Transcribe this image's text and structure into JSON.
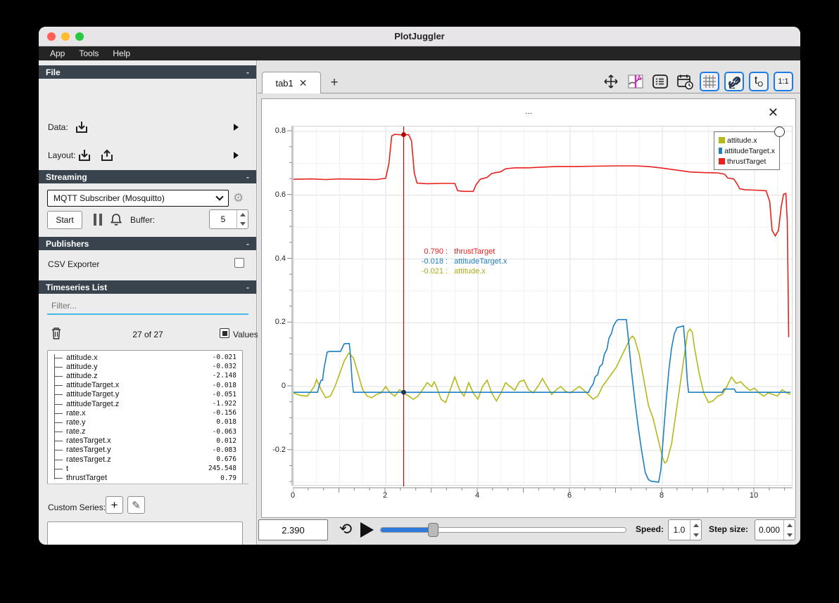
{
  "window": {
    "title": "PlotJuggler"
  },
  "menubar": {
    "items": [
      "App",
      "Tools",
      "Help"
    ]
  },
  "sidebar": {
    "file": {
      "header": "File",
      "data_label": "Data:",
      "layout_label": "Layout:"
    },
    "streaming": {
      "header": "Streaming",
      "source_selected": "MQTT Subscriber (Mosquitto)",
      "start_label": "Start",
      "buffer_label": "Buffer:",
      "buffer_value": "5"
    },
    "publishers": {
      "header": "Publishers",
      "csv_exporter_label": "CSV Exporter"
    },
    "timeseries": {
      "header": "Timeseries List",
      "filter_placeholder": "Filter...",
      "count_text": "27 of 27",
      "values_label": "Values",
      "items": [
        {
          "name": "attitude.x",
          "value": "-0.021"
        },
        {
          "name": "attitude.y",
          "value": "-0.032"
        },
        {
          "name": "attitude.z",
          "value": "-2.148"
        },
        {
          "name": "attitudeTarget.x",
          "value": "-0.018"
        },
        {
          "name": "attitudeTarget.y",
          "value": "-0.051"
        },
        {
          "name": "attitudeTarget.z",
          "value": "-1.922"
        },
        {
          "name": "rate.x",
          "value": "-0.156"
        },
        {
          "name": "rate.y",
          "value": "0.018"
        },
        {
          "name": "rate.z",
          "value": "-0.063"
        },
        {
          "name": "ratesTarget.x",
          "value": "0.012"
        },
        {
          "name": "ratesTarget.y",
          "value": "-0.083"
        },
        {
          "name": "ratesTarget.z",
          "value": "0.676"
        },
        {
          "name": "t",
          "value": "245.548"
        },
        {
          "name": "thrustTarget",
          "value": "0.79"
        }
      ]
    },
    "custom_series": {
      "label": "Custom Series:"
    }
  },
  "tabs": {
    "active": "tab1"
  },
  "toolbar_icons": {
    "time_offset_t": "t",
    "time_offset_sub": "O",
    "ratio_label": "1:1"
  },
  "plot": {
    "title": "..."
  },
  "tooltip": {
    "lines": [
      {
        "value": "0.790",
        "name": "thrustTarget",
        "color": "#e8211c"
      },
      {
        "value": "-0.018",
        "name": "attitudeTarget.x",
        "color": "#1d7fc4"
      },
      {
        "value": "-0.021",
        "name": "attitude.x",
        "color": "#a9ad15"
      }
    ]
  },
  "transport": {
    "time_value": "2.390",
    "slider_fraction": 0.21,
    "speed_label": "Speed:",
    "speed_value": "1.0",
    "step_label": "Step size:",
    "step_value": "0.000"
  },
  "chart_data": {
    "type": "line",
    "title": "...",
    "x_range": [
      0,
      10.84
    ],
    "y_range": [
      -0.313,
      0.8155
    ],
    "x_ticks": [
      0,
      2,
      4,
      6,
      8,
      10
    ],
    "y_ticks": [
      -0.2,
      0,
      0.2,
      0.4,
      0.6,
      0.8
    ],
    "grid": true,
    "legend_position": "top-right",
    "tracker": {
      "x": 2.39,
      "dots": [
        {
          "y": 0.79,
          "color": "#b00000"
        },
        {
          "y": -0.018,
          "color": "#1d3557"
        }
      ]
    },
    "series": [
      {
        "name": "attitude.x",
        "color": "#b4b819",
        "points": [
          [
            0,
            -0.02
          ],
          [
            0.15,
            -0.028
          ],
          [
            0.3,
            -0.03
          ],
          [
            0.45,
            0
          ],
          [
            0.5,
            0.022
          ],
          [
            0.6,
            -0.01
          ],
          [
            0.7,
            -0.035
          ],
          [
            0.8,
            -0.03
          ],
          [
            0.9,
            0
          ],
          [
            1,
            0.04
          ],
          [
            1.1,
            0.08
          ],
          [
            1.2,
            0.105
          ],
          [
            1.3,
            0.09
          ],
          [
            1.4,
            0.04
          ],
          [
            1.5,
            -0.01
          ],
          [
            1.6,
            -0.03
          ],
          [
            1.7,
            -0.035
          ],
          [
            1.8,
            -0.025
          ],
          [
            1.9,
            -0.02
          ],
          [
            2,
            0
          ],
          [
            2.1,
            -0.02
          ],
          [
            2.2,
            -0.03
          ],
          [
            2.3,
            -0.01
          ],
          [
            2.39,
            -0.021
          ],
          [
            2.5,
            -0.03
          ],
          [
            2.6,
            -0.04
          ],
          [
            2.7,
            -0.03
          ],
          [
            2.8,
            -0.01
          ],
          [
            2.9,
            0.012
          ],
          [
            3,
            0
          ],
          [
            3.05,
            0.015
          ],
          [
            3.1,
            0
          ],
          [
            3.2,
            -0.04
          ],
          [
            3.3,
            -0.05
          ],
          [
            3.4,
            -0.01
          ],
          [
            3.5,
            0.03
          ],
          [
            3.6,
            -0.01
          ],
          [
            3.7,
            -0.03
          ],
          [
            3.75,
            -0.01
          ],
          [
            3.8,
            0.012
          ],
          [
            3.9,
            -0.02
          ],
          [
            4,
            -0.04
          ],
          [
            4.1,
            0
          ],
          [
            4.2,
            0.02
          ],
          [
            4.3,
            -0.02
          ],
          [
            4.4,
            -0.045
          ],
          [
            4.5,
            -0.02
          ],
          [
            4.6,
            0.012
          ],
          [
            4.7,
            0
          ],
          [
            4.8,
            -0.012
          ],
          [
            4.9,
            0.015
          ],
          [
            5,
            0.02
          ],
          [
            5.1,
            -0.01
          ],
          [
            5.2,
            -0.02
          ],
          [
            5.3,
            0
          ],
          [
            5.4,
            0.025
          ],
          [
            5.5,
            0
          ],
          [
            5.6,
            -0.025
          ],
          [
            5.7,
            -0.01
          ],
          [
            5.8,
            0
          ],
          [
            5.9,
            -0.015
          ],
          [
            6,
            -0.02
          ],
          [
            6.1,
            -0.01
          ],
          [
            6.2,
            0
          ],
          [
            6.3,
            -0.012
          ],
          [
            6.5,
            -0.04
          ],
          [
            6.6,
            -0.03
          ],
          [
            6.7,
            0
          ],
          [
            6.8,
            0.02
          ],
          [
            6.9,
            0.04
          ],
          [
            7,
            0.06
          ],
          [
            7.1,
            0.09
          ],
          [
            7.2,
            0.12
          ],
          [
            7.3,
            0.15
          ],
          [
            7.35,
            0.158
          ],
          [
            7.4,
            0.15
          ],
          [
            7.5,
            0.1
          ],
          [
            7.6,
            0.02
          ],
          [
            7.7,
            -0.06
          ],
          [
            7.8,
            -0.1
          ],
          [
            7.9,
            -0.16
          ],
          [
            8,
            -0.22
          ],
          [
            8.05,
            -0.24
          ],
          [
            8.1,
            -0.235
          ],
          [
            8.2,
            -0.18
          ],
          [
            8.3,
            -0.08
          ],
          [
            8.4,
            0.02
          ],
          [
            8.5,
            0.12
          ],
          [
            8.55,
            0.17
          ],
          [
            8.6,
            0.18
          ],
          [
            8.65,
            0.17
          ],
          [
            8.7,
            0.12
          ],
          [
            8.8,
            0.04
          ],
          [
            8.9,
            -0.02
          ],
          [
            9,
            -0.05
          ],
          [
            9.1,
            -0.045
          ],
          [
            9.2,
            -0.03
          ],
          [
            9.3,
            -0.025
          ],
          [
            9.4,
            0
          ],
          [
            9.5,
            0.03
          ],
          [
            9.55,
            0.02
          ],
          [
            9.6,
            0.01
          ],
          [
            9.7,
            0.015
          ],
          [
            9.8,
            0
          ],
          [
            9.9,
            -0.012
          ],
          [
            10,
            -0.005
          ],
          [
            10.1,
            -0.02
          ],
          [
            10.2,
            -0.03
          ],
          [
            10.3,
            -0.02
          ],
          [
            10.4,
            -0.025
          ],
          [
            10.5,
            -0.03
          ],
          [
            10.6,
            -0.01
          ],
          [
            10.7,
            -0.02
          ],
          [
            10.78,
            -0.025
          ]
        ]
      },
      {
        "name": "attitudeTarget.x",
        "color": "#1d7fc4",
        "points": [
          [
            0,
            -0.018
          ],
          [
            0.52,
            -0.018
          ],
          [
            0.56,
            0.005
          ],
          [
            0.6,
            0.02
          ],
          [
            0.63,
            0.02
          ],
          [
            0.66,
            0.055
          ],
          [
            0.7,
            0.085
          ],
          [
            0.73,
            0.108
          ],
          [
            0.78,
            0.11
          ],
          [
            1.02,
            0.11
          ],
          [
            1.06,
            0.122
          ],
          [
            1.1,
            0.134
          ],
          [
            1.21,
            0.135
          ],
          [
            1.24,
            0.09
          ],
          [
            1.27,
            0.02
          ],
          [
            1.3,
            -0.018
          ],
          [
            3,
            -0.018
          ],
          [
            6.4,
            -0.018
          ],
          [
            6.44,
            -0.005
          ],
          [
            6.5,
            0.008
          ],
          [
            6.54,
            0.03
          ],
          [
            6.6,
            0.038
          ],
          [
            6.64,
            0.062
          ],
          [
            6.7,
            0.07
          ],
          [
            6.74,
            0.1
          ],
          [
            6.8,
            0.118
          ],
          [
            6.84,
            0.15
          ],
          [
            6.9,
            0.168
          ],
          [
            6.94,
            0.19
          ],
          [
            7,
            0.205
          ],
          [
            7.04,
            0.21
          ],
          [
            7.22,
            0.21
          ],
          [
            7.27,
            0.14
          ],
          [
            7.33,
            0.05
          ],
          [
            7.4,
            -0.04
          ],
          [
            7.48,
            -0.13
          ],
          [
            7.56,
            -0.21
          ],
          [
            7.63,
            -0.27
          ],
          [
            7.7,
            -0.292
          ],
          [
            7.76,
            -0.297
          ],
          [
            7.92,
            -0.3
          ],
          [
            7.97,
            -0.26
          ],
          [
            8.02,
            -0.16
          ],
          [
            8.08,
            -0.05
          ],
          [
            8.14,
            0.05
          ],
          [
            8.2,
            0.12
          ],
          [
            8.26,
            0.165
          ],
          [
            8.32,
            0.185
          ],
          [
            8.46,
            0.19
          ],
          [
            8.5,
            0.12
          ],
          [
            8.54,
            0.02
          ],
          [
            8.57,
            -0.018
          ],
          [
            9.3,
            -0.018
          ],
          [
            9.34,
            -0.008
          ],
          [
            9.56,
            -0.008
          ],
          [
            9.6,
            -0.018
          ],
          [
            10.78,
            -0.018
          ]
        ]
      },
      {
        "name": "thrustTarget",
        "color": "#e8211c",
        "points": [
          [
            0,
            0.65
          ],
          [
            0.4,
            0.651
          ],
          [
            0.7,
            0.649
          ],
          [
            1,
            0.651
          ],
          [
            1.4,
            0.65
          ],
          [
            1.8,
            0.649
          ],
          [
            2,
            0.653
          ],
          [
            2.07,
            0.7
          ],
          [
            2.13,
            0.786
          ],
          [
            2.2,
            0.791
          ],
          [
            2.35,
            0.789
          ],
          [
            2.5,
            0.79
          ],
          [
            2.56,
            0.77
          ],
          [
            2.62,
            0.67
          ],
          [
            2.68,
            0.638
          ],
          [
            2.9,
            0.636
          ],
          [
            3.2,
            0.637
          ],
          [
            3.5,
            0.637
          ],
          [
            3.56,
            0.614
          ],
          [
            3.7,
            0.612
          ],
          [
            3.9,
            0.612
          ],
          [
            3.96,
            0.633
          ],
          [
            4.05,
            0.65
          ],
          [
            4.2,
            0.656
          ],
          [
            4.3,
            0.668
          ],
          [
            4.5,
            0.674
          ],
          [
            4.6,
            0.683
          ],
          [
            4.8,
            0.686
          ],
          [
            5.1,
            0.686
          ],
          [
            5.4,
            0.688
          ],
          [
            5.7,
            0.69
          ],
          [
            6.1,
            0.69
          ],
          [
            6.5,
            0.691
          ],
          [
            7,
            0.692
          ],
          [
            7.4,
            0.692
          ],
          [
            7.7,
            0.69
          ],
          [
            8,
            0.685
          ],
          [
            8.3,
            0.679
          ],
          [
            8.6,
            0.673
          ],
          [
            8.9,
            0.671
          ],
          [
            9.2,
            0.67
          ],
          [
            9.35,
            0.666
          ],
          [
            9.42,
            0.654
          ],
          [
            9.55,
            0.651
          ],
          [
            9.62,
            0.636
          ],
          [
            9.68,
            0.62
          ],
          [
            9.8,
            0.617
          ],
          [
            10,
            0.616
          ],
          [
            10.25,
            0.614
          ],
          [
            10.33,
            0.58
          ],
          [
            10.38,
            0.49
          ],
          [
            10.45,
            0.472
          ],
          [
            10.52,
            0.49
          ],
          [
            10.58,
            0.565
          ],
          [
            10.63,
            0.603
          ],
          [
            10.68,
            0.606
          ],
          [
            10.71,
            0.52
          ],
          [
            10.73,
            0.3
          ],
          [
            10.74,
            0.155
          ]
        ]
      }
    ]
  }
}
